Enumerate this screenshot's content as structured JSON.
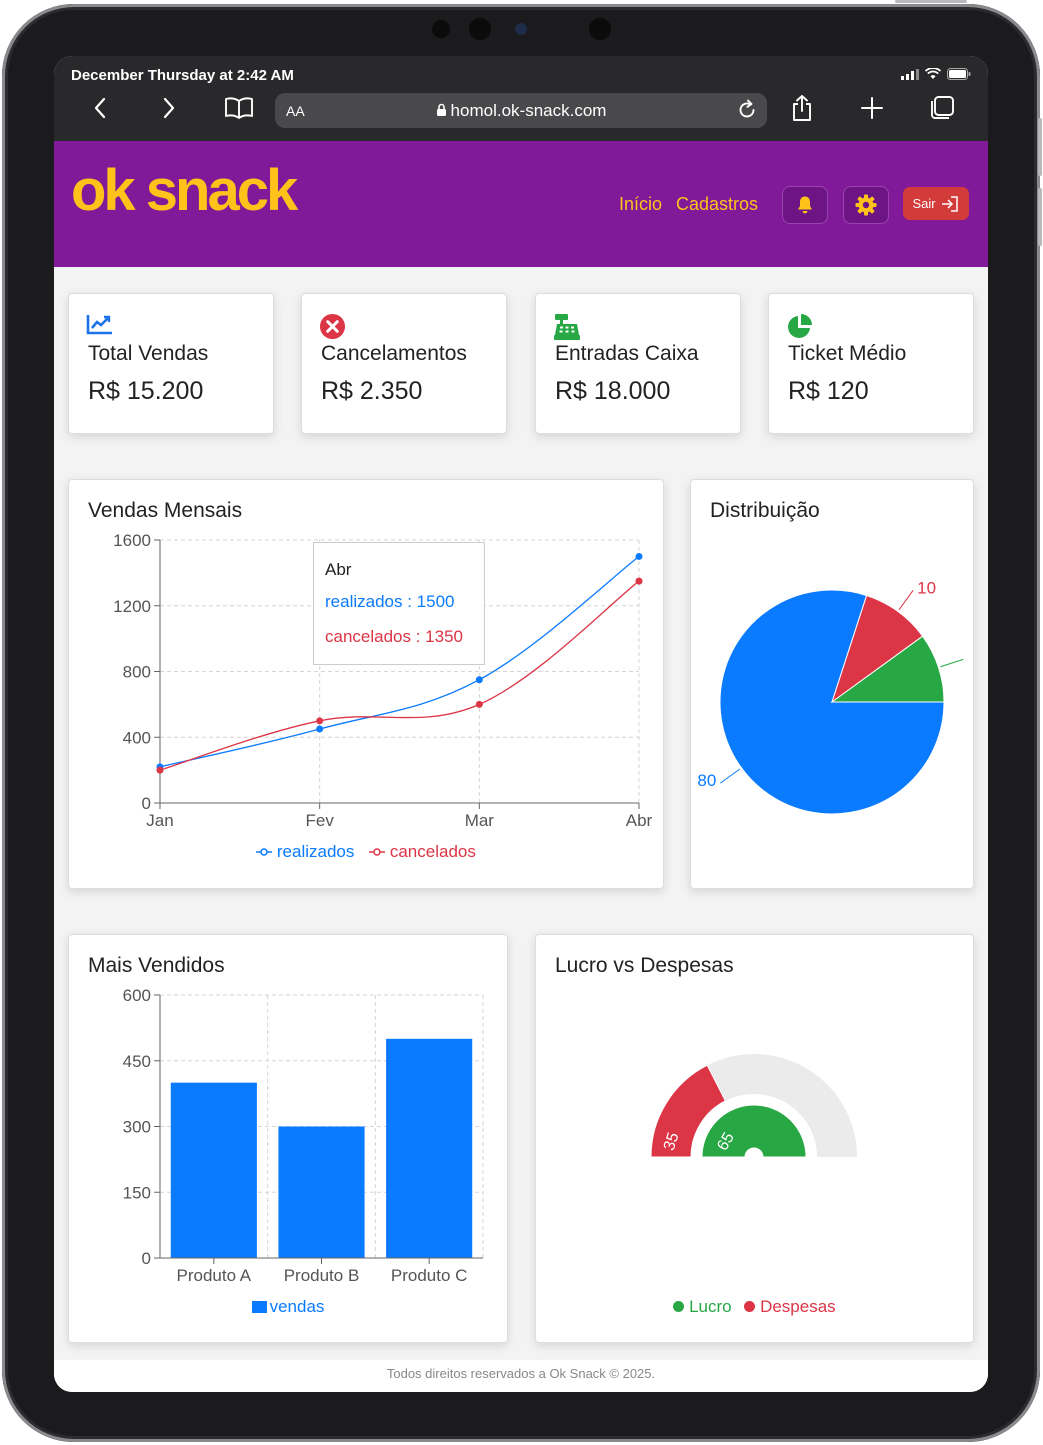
{
  "status": {
    "time": "December Thursday at 2:42 AM"
  },
  "browser": {
    "aa": "AA",
    "url": "homol.ok-snack.com"
  },
  "header": {
    "logo": "ok snack",
    "nav": [
      "Início",
      "Cadastros"
    ],
    "logout_label": "Sair"
  },
  "stats": [
    {
      "title": "Total Vendas",
      "value": "R$ 15.200",
      "icon": "trend-chart-icon",
      "color": "#1a73e8"
    },
    {
      "title": "Cancelamentos",
      "value": "R$ 2.350",
      "icon": "cancel-circle-icon",
      "color": "#dc3545"
    },
    {
      "title": "Entradas Caixa",
      "value": "R$ 18.000",
      "icon": "cash-register-icon",
      "color": "#28a745"
    },
    {
      "title": "Ticket Médio",
      "value": "R$ 120",
      "icon": "pie-icon",
      "color": "#28a745"
    }
  ],
  "colors": {
    "blue": "#0a7bff",
    "red": "#dc3545",
    "green": "#28a745",
    "purple": "#801a99",
    "yellow": "#ffc21a"
  },
  "chart_data": [
    {
      "type": "line",
      "title": "Vendas Mensais",
      "categories": [
        "Jan",
        "Fev",
        "Mar",
        "Abr"
      ],
      "series": [
        {
          "name": "realizados",
          "values": [
            220,
            450,
            750,
            1500
          ],
          "color": "#0a7bff"
        },
        {
          "name": "cancelados",
          "values": [
            200,
            500,
            600,
            1350
          ],
          "color": "#dc3545"
        }
      ],
      "ylim": [
        0,
        1600
      ],
      "yticks": [
        0,
        400,
        800,
        1200,
        1600
      ],
      "grid": true,
      "legend": "bottom",
      "tooltip": {
        "category": "Abr",
        "lines": [
          "realizados : 1500",
          "cancelados : 1350"
        ]
      }
    },
    {
      "type": "pie",
      "title": "Distribuição",
      "slices": [
        {
          "value": 80,
          "color": "#0a7bff",
          "label": "80"
        },
        {
          "value": 10,
          "color": "#dc3545",
          "label": "10"
        },
        {
          "value": 10,
          "color": "#28a745",
          "label": ""
        }
      ]
    },
    {
      "type": "bar",
      "title": "Mais Vendidos",
      "categories": [
        "Produto A",
        "Produto B",
        "Produto C"
      ],
      "series": [
        {
          "name": "vendas",
          "values": [
            400,
            300,
            500
          ],
          "color": "#0a7bff"
        }
      ],
      "ylim": [
        0,
        600
      ],
      "yticks": [
        0,
        150,
        300,
        450,
        600
      ],
      "grid": true,
      "legend": "bottom"
    },
    {
      "type": "pie",
      "title": "Lucro vs Despesas",
      "variant": "half-donut",
      "rings": [
        {
          "name": "Despesas",
          "value": 35,
          "total": 100,
          "color": "#dc3545"
        },
        {
          "name": "Lucro",
          "value": 65,
          "total": 65,
          "color": "#28a745"
        }
      ],
      "legend": [
        {
          "name": "Lucro",
          "color": "#28a745"
        },
        {
          "name": "Despesas",
          "color": "#dc3545"
        }
      ]
    }
  ],
  "footer": "Todos direitos reservados a Ok Snack © 2025."
}
